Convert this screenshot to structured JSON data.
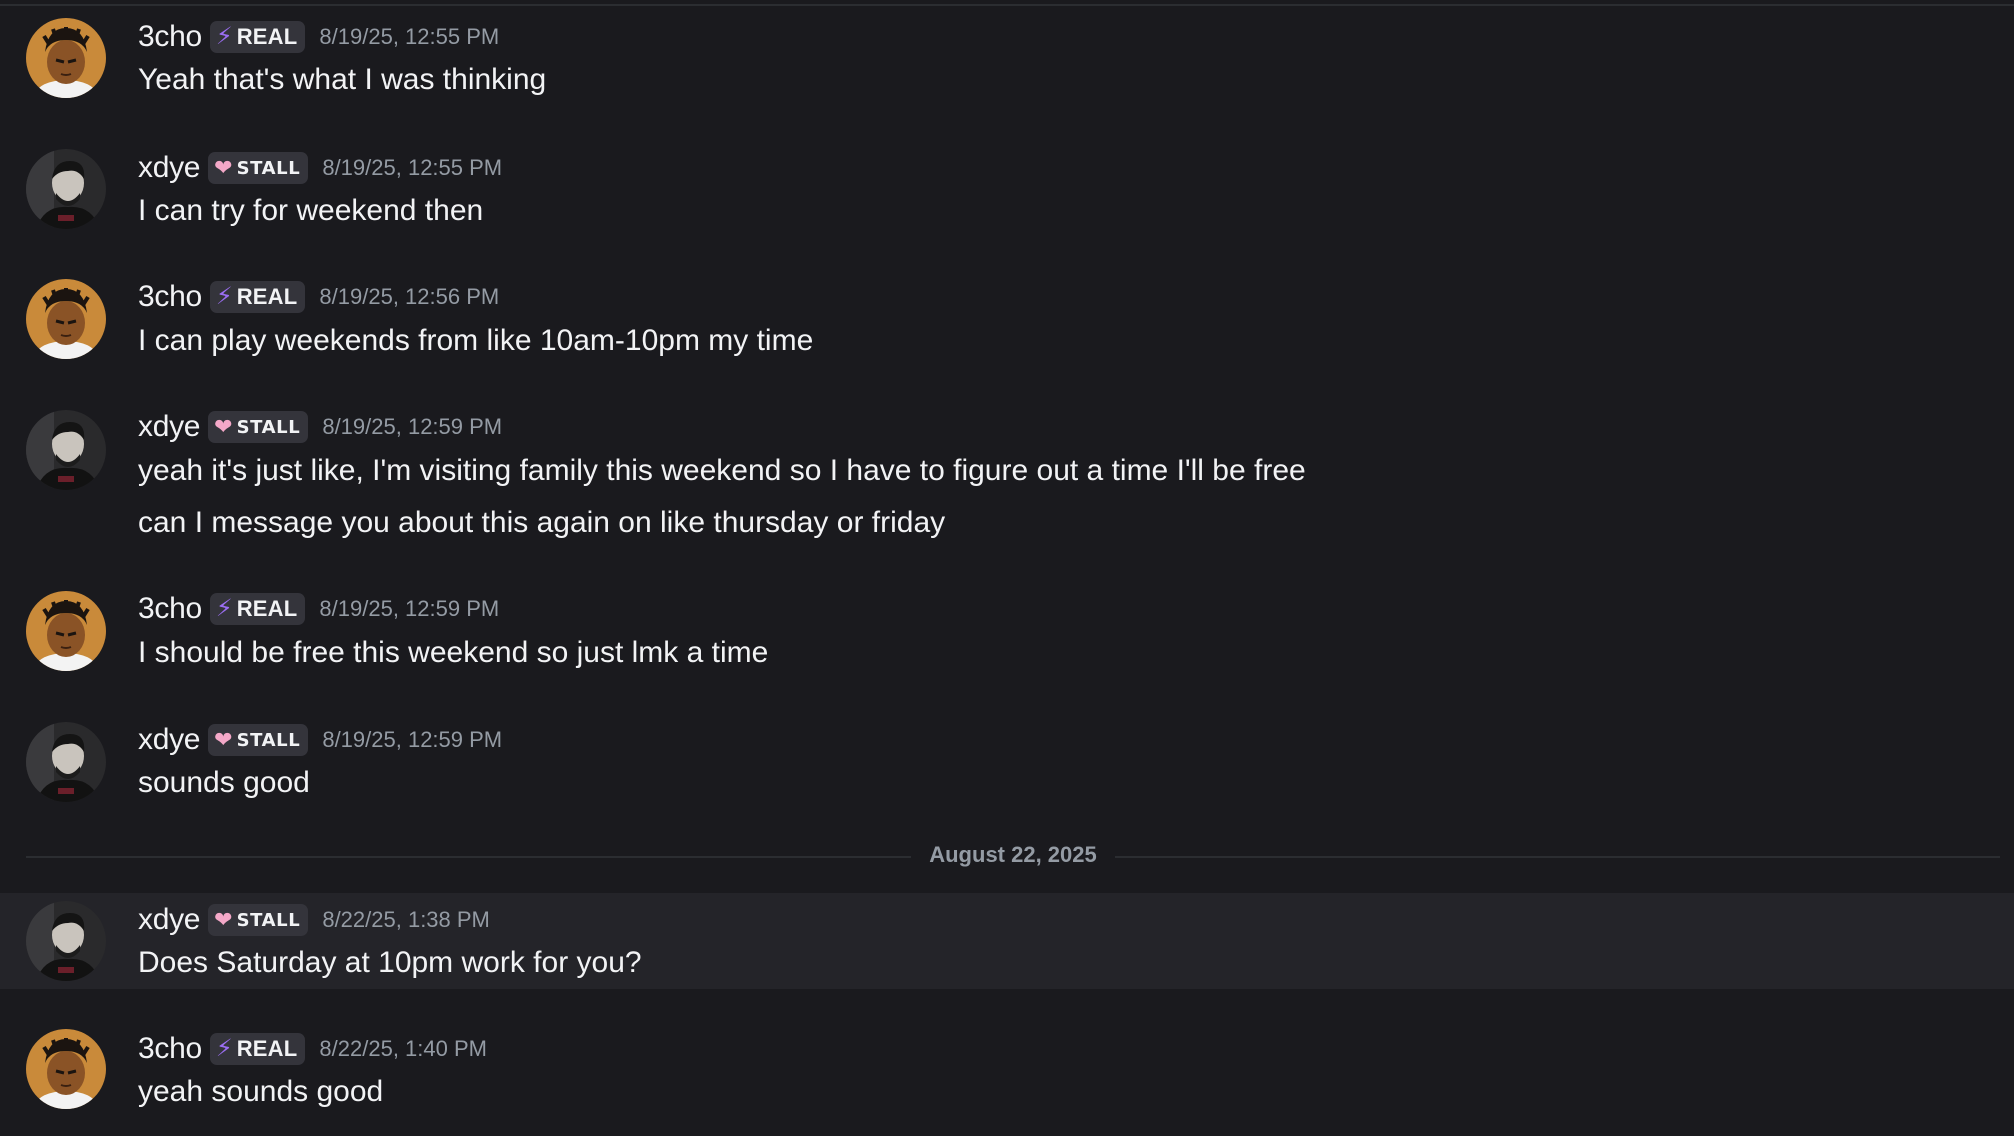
{
  "messages": [
    {
      "author": "3cho",
      "tag_icon": "lightning-icon",
      "tag": "REAL",
      "timestamp": "8/19/25, 12:55 PM",
      "lines": [
        "Yeah that's what I was thinking"
      ]
    },
    {
      "author": "xdye",
      "tag_icon": "heart-icon",
      "tag": "STALL",
      "timestamp": "8/19/25, 12:55 PM",
      "lines": [
        "I can try for weekend then"
      ]
    },
    {
      "author": "3cho",
      "tag_icon": "lightning-icon",
      "tag": "REAL",
      "timestamp": "8/19/25, 12:56 PM",
      "lines": [
        "I can play weekends from like 10am-10pm my time"
      ]
    },
    {
      "author": "xdye",
      "tag_icon": "heart-icon",
      "tag": "STALL",
      "timestamp": "8/19/25, 12:59 PM",
      "lines": [
        "yeah it's just like, I'm visiting family this weekend so I have to figure out a time I'll be free",
        "can I message you about this again on like thursday or friday"
      ]
    },
    {
      "author": "3cho",
      "tag_icon": "lightning-icon",
      "tag": "REAL",
      "timestamp": "8/19/25, 12:59 PM",
      "lines": [
        "I should be free this weekend so just lmk a time"
      ]
    },
    {
      "author": "xdye",
      "tag_icon": "heart-icon",
      "tag": "STALL",
      "timestamp": "8/19/25, 12:59 PM",
      "lines": [
        "sounds good"
      ]
    },
    {
      "author": "xdye",
      "tag_icon": "heart-icon",
      "tag": "STALL",
      "timestamp": "8/22/25, 1:38 PM",
      "lines": [
        "Does Saturday at 10pm work for you?"
      ]
    },
    {
      "author": "3cho",
      "tag_icon": "lightning-icon",
      "tag": "REAL",
      "timestamp": "8/22/25, 1:40 PM",
      "lines": [
        "yeah sounds good"
      ]
    }
  ],
  "date_divider": "August 22, 2025",
  "colors": {
    "background": "#1a1a1e",
    "highlight_row": "#242429",
    "real_tag_icon": "#9b6ef3",
    "stall_tag_icon": "#f4a8c8",
    "timestamp": "#949ba4",
    "text": "#f2f3f5"
  }
}
